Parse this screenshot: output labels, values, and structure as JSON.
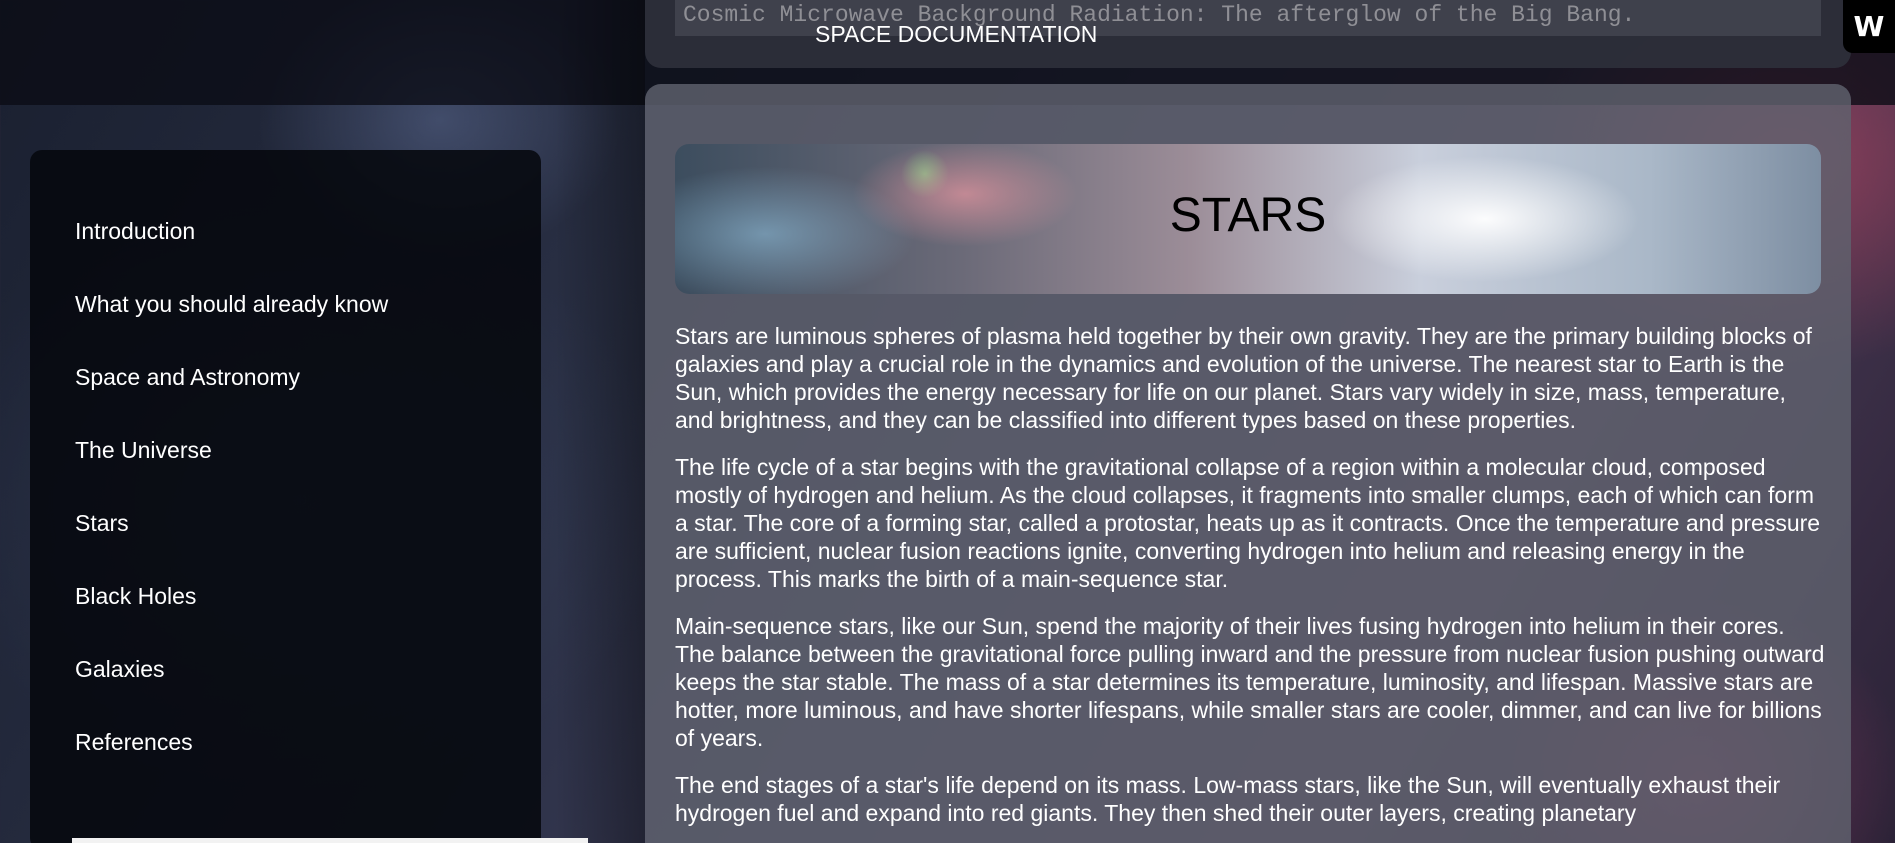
{
  "header": {
    "quote": "Cosmic Microwave Background Radiation: The afterglow of the Big Bang.",
    "site_title": "SPACE DOCUMENTATION"
  },
  "sidebar": {
    "items": [
      {
        "label": "Introduction"
      },
      {
        "label": "What you should already know"
      },
      {
        "label": "Space and Astronomy"
      },
      {
        "label": "The Universe"
      },
      {
        "label": "Stars"
      },
      {
        "label": "Black Holes"
      },
      {
        "label": "Galaxies"
      },
      {
        "label": "References"
      }
    ]
  },
  "main": {
    "section_title": "STARS",
    "paragraphs": [
      "Stars are luminous spheres of plasma held together by their own gravity. They are the primary building blocks of galaxies and play a crucial role in the dynamics and evolution of the universe. The nearest star to Earth is the Sun, which provides the energy necessary for life on our planet. Stars vary widely in size, mass, temperature, and brightness, and they can be classified into different types based on these properties.",
      "The life cycle of a star begins with the gravitational collapse of a region within a molecular cloud, composed mostly of hydrogen and helium. As the cloud collapses, it fragments into smaller clumps, each of which can form a star. The core of a forming star, called a protostar, heats up as it contracts. Once the temperature and pressure are sufficient, nuclear fusion reactions ignite, converting hydrogen into helium and releasing energy in the process. This marks the birth of a main-sequence star.",
      "Main-sequence stars, like our Sun, spend the majority of their lives fusing hydrogen into helium in their cores. The balance between the gravitational force pulling inward and the pressure from nuclear fusion pushing outward keeps the star stable. The mass of a star determines its temperature, luminosity, and lifespan. Massive stars are hotter, more luminous, and have shorter lifespans, while smaller stars are cooler, dimmer, and can live for billions of years.",
      "The end stages of a star's life depend on its mass. Low-mass stars, like the Sun, will eventually exhaust their hydrogen fuel and expand into red giants. They then shed their outer layers, creating planetary"
    ]
  },
  "logo": {
    "text": "W",
    "icon": "w-logo-icon"
  }
}
